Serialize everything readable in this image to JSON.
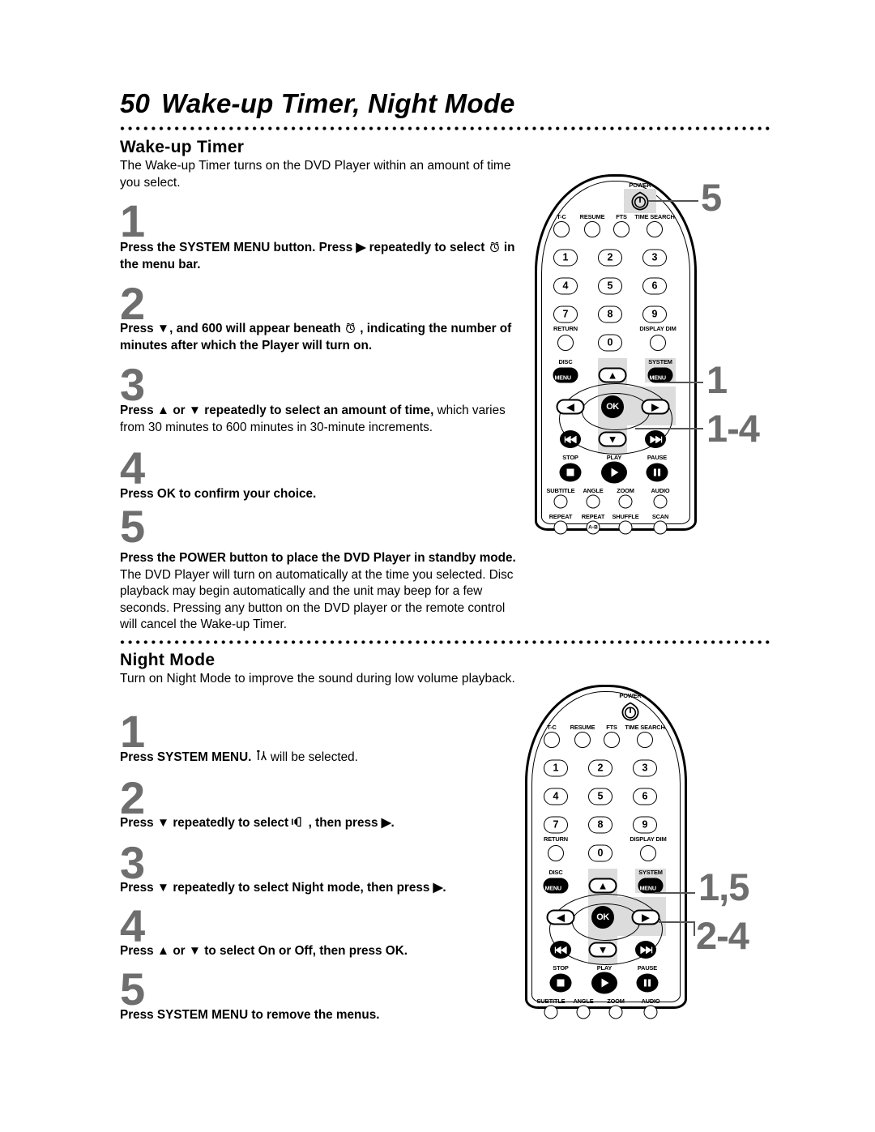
{
  "page": {
    "number": "50",
    "title": "Wake-up Timer, Night Mode"
  },
  "sections": [
    {
      "id": "wake_up_timer",
      "heading": "Wake-up Timer",
      "intro": "The Wake-up Timer turns on the DVD Player within an amount of time you select.",
      "steps": [
        {
          "number": "1",
          "bold": "Press the SYSTEM MENU button. Press ▶ repeatedly to select",
          "glyph": "alarm-clock-icon",
          "bold_tail": "in the menu bar.",
          "regular": ""
        },
        {
          "number": "2",
          "bold": "Press ▼, and 600 will appear beneath",
          "glyph": "alarm-clock-icon",
          "bold_tail": ", indicating the number of minutes after which the Player will turn on.",
          "regular": ""
        },
        {
          "number": "3",
          "bold": "Press ▲ or ▼ repeatedly to select an amount of time,",
          "glyph": "",
          "bold_tail": "",
          "regular": "which varies from 30 minutes to 600 minutes in 30-minute increments."
        },
        {
          "number": "4",
          "bold": "Press OK to confirm your choice.",
          "glyph": "",
          "bold_tail": "",
          "regular": ""
        },
        {
          "number": "5",
          "bold": "Press the POWER button to place the DVD Player in standby mode.",
          "glyph": "",
          "bold_tail": "",
          "regular": "The DVD Player will turn on automatically at the time you selected. Disc playback may begin automatically and the unit may beep for a few seconds. Pressing any button on the DVD player or the remote control will cancel the Wake-up Timer."
        }
      ]
    },
    {
      "id": "night_mode",
      "heading": "Night Mode",
      "intro": "Turn on Night Mode to improve the sound during low volume playback.",
      "steps": [
        {
          "number": "1",
          "bold": "Press SYSTEM MENU.",
          "glyph": "tools-setup-icon",
          "bold_tail": "",
          "regular": "will be selected."
        },
        {
          "number": "2",
          "bold": "Press ▼ repeatedly to select",
          "glyph": "speaker-icon",
          "bold_tail": ", then press ▶.",
          "regular": ""
        },
        {
          "number": "3",
          "bold": "Press ▼ repeatedly to select Night mode, then press ▶.",
          "glyph": "",
          "bold_tail": "",
          "regular": ""
        },
        {
          "number": "4",
          "bold": "Press ▲ or ▼ to select On or Off, then press OK.",
          "glyph": "",
          "bold_tail": "",
          "regular": ""
        },
        {
          "number": "5",
          "bold": "Press SYSTEM MENU to remove the menus.",
          "glyph": "",
          "bold_tail": "",
          "regular": ""
        }
      ]
    }
  ],
  "remote": {
    "power_label": "POWER",
    "row_top": [
      "T-C",
      "RESUME",
      "FTS",
      "TIME SEARCH"
    ],
    "numbers": [
      "1",
      "2",
      "3",
      "4",
      "5",
      "6",
      "7",
      "8",
      "9",
      "0"
    ],
    "return_label": "RETURN",
    "display_dim_label": "DISPLAY DIM",
    "disc_label": "DISC",
    "system_label": "SYSTEM",
    "menu_label": "MENU",
    "ok_label": "OK",
    "stop_label": "STOP",
    "play_label": "PLAY",
    "pause_label": "PAUSE",
    "row_subtitle": [
      "SUBTITLE",
      "ANGLE",
      "ZOOM",
      "AUDIO"
    ],
    "row_repeat": [
      "REPEAT",
      "REPEAT",
      "SHUFFLE",
      "SCAN"
    ],
    "repeat_ab_label": "A-B"
  },
  "callouts": {
    "remote1": [
      "5",
      "1",
      "1-4"
    ],
    "remote2": [
      "1,5",
      "2-4"
    ]
  },
  "colors": {
    "step_number": "#6e6e6e",
    "callout": "#6e6e6e",
    "highlight": "#dcdcdc",
    "ink": "#000000",
    "paper": "#ffffff"
  }
}
